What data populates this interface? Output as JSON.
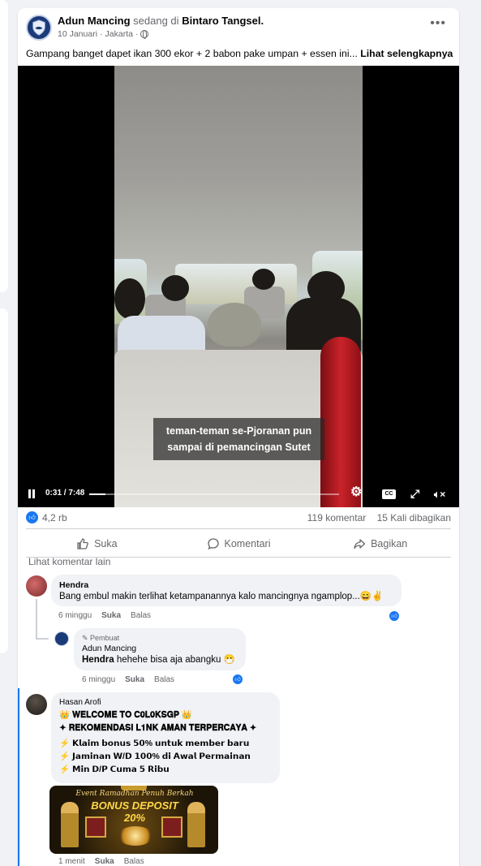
{
  "post": {
    "author": "Adun Mancing",
    "status_prefix": "sedang di",
    "location": "Bintaro Tangsel.",
    "date": "10 Januari",
    "place": "Jakarta",
    "caption": "Gampang banget dapet ikan 300 ekor + 2 babon pake umpan + essen ini...",
    "see_more": "Lihat selengkapnya"
  },
  "video": {
    "subtitle_line1": "teman-teman se-Pjoranan pun",
    "subtitle_line2": "sampai di pemancingan Sutet",
    "timecode": "0:31 / 7:48",
    "progress": 0.066,
    "cc_label": "CC"
  },
  "stats": {
    "likes": "4,2 rb",
    "comments": "119 komentar",
    "shares": "15 Kali dibagikan"
  },
  "actions": {
    "like": "Suka",
    "comment": "Komentari",
    "share": "Bagikan"
  },
  "more_comments": "Lihat komentar lain",
  "comments": [
    {
      "name": "Hendra",
      "text": "Bang embul makin terlihat ketampanannya kalo mancingnya ngamplop...😄✌️",
      "time": "6 minggu",
      "like": "Suka",
      "reply": "Balas"
    },
    {
      "badge": "Pembuat",
      "name": "Adun Mancing",
      "mention": "Hendra",
      "text": "hehehe bisa aja abangku 😷",
      "time": "6 minggu",
      "like": "Suka",
      "reply": "Balas"
    },
    {
      "name": "Hasan Arofi",
      "line1": "👑 𝐖𝐄𝐋𝐂𝐎𝐌𝐄 𝐓𝐎 𝐂𝟎𝐋𝟎𝐊𝐒𝐆𝐏 👑",
      "line2": "✦ 𝐑𝐄𝐊𝐎𝐌𝐄𝐍𝐃𝐀𝐒𝐈 𝐋𝟏𝐍𝐊 𝐀𝐌𝐀𝐍 𝐓𝐄𝐑𝐏𝐄𝐑𝐂𝐀𝐘𝐀 ✦",
      "line3": "⚡ 𝗞𝗹𝗮𝗶𝗺 𝗯𝗼𝗻𝘂𝘀 𝟱𝟬% 𝘂𝗻𝘁𝘂𝗸 𝗺𝗲𝗺𝗯𝗲𝗿 𝗯𝗮𝗿𝘂",
      "line4": "⚡ 𝗝𝗮𝗺𝗶𝗻𝗮𝗻 𝗪/𝗗 𝟭𝟬𝟬% 𝗱𝗶 𝗔𝘄𝗮𝗹 𝗣𝗲𝗿𝗺𝗮𝗶𝗻𝗮𝗻",
      "line5": "⚡ 𝗠𝗶𝗻 𝗗/𝗣 𝗖𝘂𝗺𝗮 𝟱 𝗥𝗶𝗯𝘂",
      "ad_line1": "Event Ramadhan Penuh Berkah",
      "ad_line2": "BONUS DEPOSIT 20%",
      "time": "1 menit",
      "like": "Suka",
      "reply": "Balas"
    }
  ],
  "colors": {
    "accent": "#1877f2",
    "muted": "#65676b",
    "bubble": "#f0f2f5"
  }
}
